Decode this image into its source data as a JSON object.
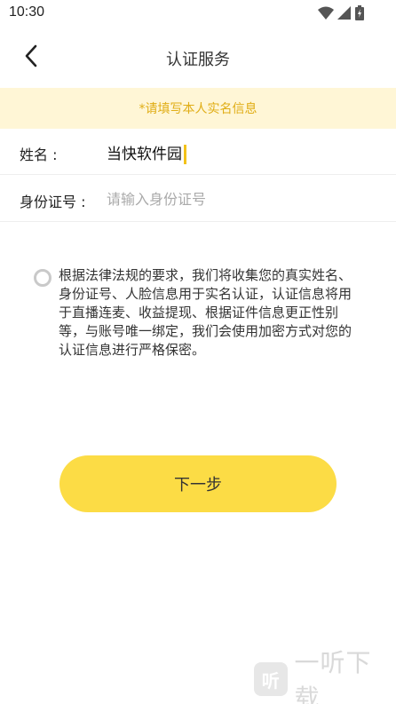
{
  "status_bar": {
    "time": "10:30",
    "icons": [
      "wifi-icon",
      "signal-icon",
      "battery-icon"
    ]
  },
  "nav": {
    "back_icon": "chevron-left-icon",
    "title": "认证服务"
  },
  "notice": {
    "text": "*请填写本人实名信息",
    "color": "#e0ad15",
    "background": "#fff6d6"
  },
  "form": {
    "name": {
      "label": "姓名 :",
      "value": "当快软件园"
    },
    "id_number": {
      "label": "身份证号 :",
      "value": "",
      "placeholder": "请输入身份证号"
    }
  },
  "agreement": {
    "checked": false,
    "text": "根据法律法规的要求，我们将收集您的真实姓名、身份证号、人脸信息用于实名认证，认证信息将用于直播连麦、收益提现、根据证件信息更正性别等，与账号唯一绑定，我们会使用加密方式对您的认证信息进行严格保密。"
  },
  "next_button": {
    "label": "下一步",
    "color": "#fcdc45"
  },
  "watermark": {
    "logo_text": "听",
    "text": "一听下载"
  }
}
